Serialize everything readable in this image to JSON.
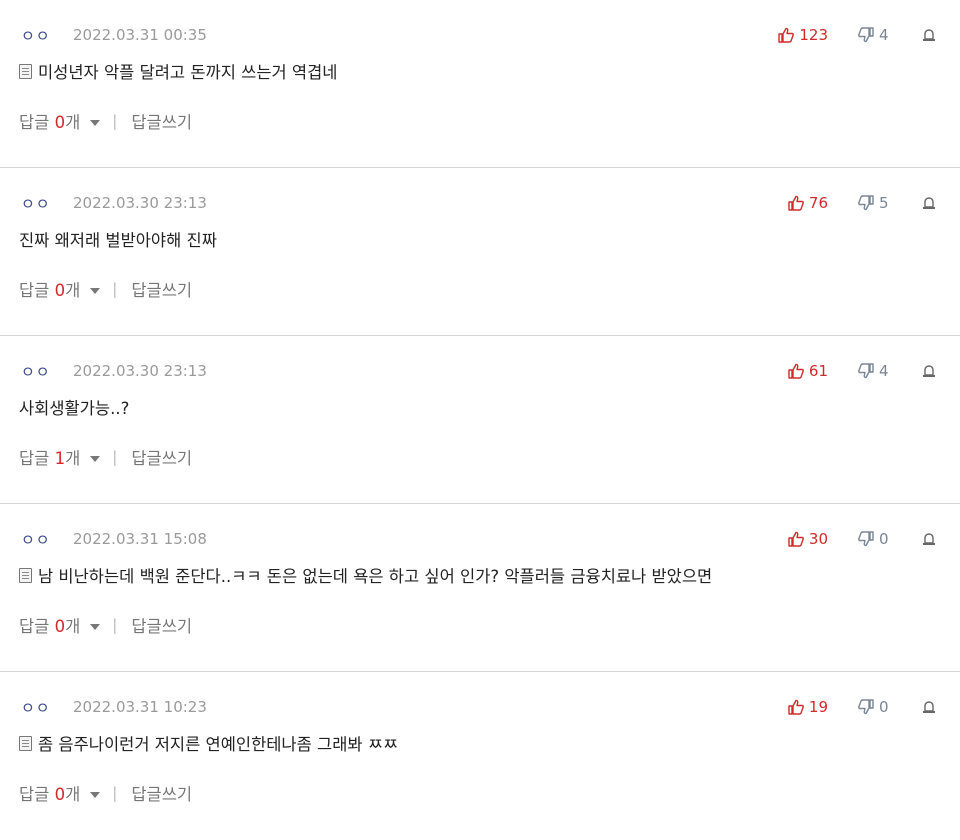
{
  "comments": [
    {
      "author": "ㅇㅇ",
      "date": "2022.03.31 00:35",
      "has_doc_icon": true,
      "text": "미성년자 악플 달려고 돈까지 쓰는거 역겹네",
      "reply_prefix": "답글 ",
      "reply_count": "0",
      "reply_suffix": "개",
      "write_label": "답글쓰기",
      "up": "123",
      "down": "4"
    },
    {
      "author": "ㅇㅇ",
      "date": "2022.03.30 23:13",
      "has_doc_icon": false,
      "text": "진짜 왜저래 벌받아야해 진짜",
      "reply_prefix": "답글 ",
      "reply_count": "0",
      "reply_suffix": "개",
      "write_label": "답글쓰기",
      "up": "76",
      "down": "5"
    },
    {
      "author": "ㅇㅇ",
      "date": "2022.03.30 23:13",
      "has_doc_icon": false,
      "text": "사회생활가능..?",
      "reply_prefix": "답글 ",
      "reply_count": "1",
      "reply_suffix": "개",
      "write_label": "답글쓰기",
      "up": "61",
      "down": "4"
    },
    {
      "author": "ㅇㅇ",
      "date": "2022.03.31 15:08",
      "has_doc_icon": true,
      "text": "남 비난하는데 백원 준단다..ㅋㅋ 돈은 없는데 욕은 하고 싶어 인가? 악플러들 금융치료나 받았으면",
      "reply_prefix": "답글 ",
      "reply_count": "0",
      "reply_suffix": "개",
      "write_label": "답글쓰기",
      "up": "30",
      "down": "0"
    },
    {
      "author": "ㅇㅇ",
      "date": "2022.03.31 10:23",
      "has_doc_icon": true,
      "text": "좀 음주나이런거 저지른 연예인한테나좀 그래봐 ㅉㅉ",
      "reply_prefix": "답글 ",
      "reply_count": "0",
      "reply_suffix": "개",
      "write_label": "답글쓰기",
      "up": "19",
      "down": "0"
    }
  ],
  "icons": {
    "doc": "document-icon",
    "up": "thumbs-up-icon",
    "down": "thumbs-down-icon",
    "report": "report-icon",
    "caret": "chevron-down-icon"
  },
  "colors": {
    "vote_up": "#d12a2a",
    "vote_down": "#7a8591",
    "reply_count": "#d12a2a",
    "author": "#3b4a8a"
  }
}
